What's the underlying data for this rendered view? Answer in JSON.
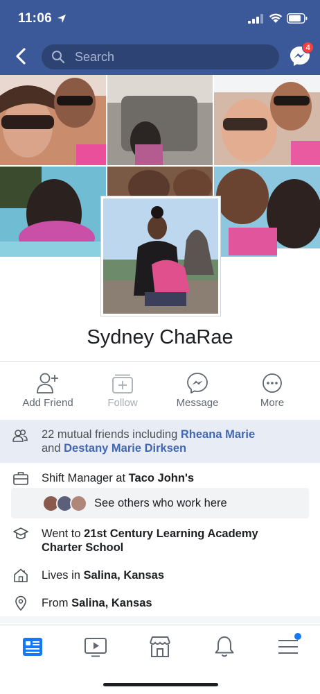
{
  "status_bar": {
    "time": "11:06"
  },
  "header": {
    "search_placeholder": "Search",
    "messenger_badge": "4"
  },
  "profile": {
    "name": "Sydney ChaRae"
  },
  "actions": [
    {
      "label": "Add Friend",
      "icon": "add-friend-icon",
      "enabled": true
    },
    {
      "label": "Follow",
      "icon": "follow-icon",
      "enabled": false
    },
    {
      "label": "Message",
      "icon": "messenger-icon",
      "enabled": true
    },
    {
      "label": "More",
      "icon": "more-icon",
      "enabled": true
    }
  ],
  "mutual": {
    "count_text": "22 mutual friends including",
    "friend1": "Rheana Marie",
    "and": "and",
    "friend2": "Destany Marie Dirksen"
  },
  "about": {
    "work": {
      "prefix": "Shift Manager at",
      "place": "Taco John's"
    },
    "coworkers": "See others who work here",
    "education": {
      "prefix": "Went to",
      "place": "21st Century Learning Academy Charter School"
    },
    "lives": {
      "prefix": "Lives in",
      "place": "Salina, Kansas"
    },
    "from": {
      "prefix": "From",
      "place": "Salina, Kansas"
    }
  },
  "tabs": [
    "news-feed-icon",
    "watch-icon",
    "marketplace-icon",
    "notifications-icon",
    "menu-icon"
  ],
  "colors": {
    "brand": "#3b5998",
    "link": "#4267b2",
    "badge": "#fa3e3e",
    "active_tab": "#1877f2"
  }
}
